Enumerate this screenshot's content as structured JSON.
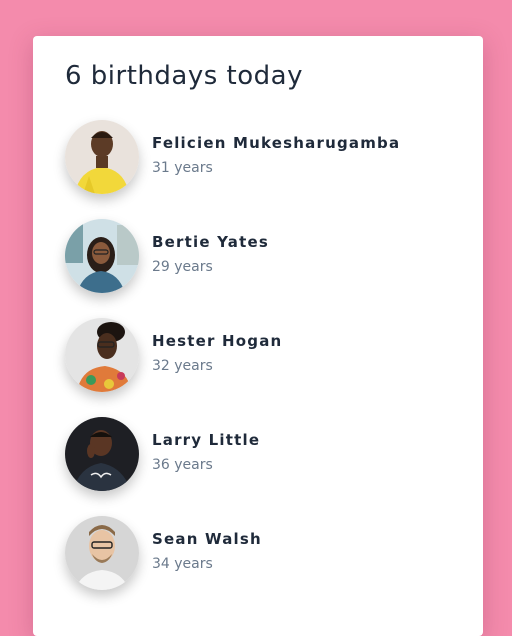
{
  "header": {
    "title": "6 birthdays today"
  },
  "people": [
    {
      "name": "Felicien Mukesharugamba",
      "age": "31 years",
      "avatar_icon": "person-photo-icon"
    },
    {
      "name": "Bertie Yates",
      "age": "29 years",
      "avatar_icon": "person-photo-icon"
    },
    {
      "name": "Hester Hogan",
      "age": "32 years",
      "avatar_icon": "person-photo-icon"
    },
    {
      "name": "Larry Little",
      "age": "36 years",
      "avatar_icon": "person-photo-icon"
    },
    {
      "name": "Sean Walsh",
      "age": "34 years",
      "avatar_icon": "person-photo-icon"
    }
  ],
  "colors": {
    "background": "#f48bac",
    "card": "#ffffff",
    "title_text": "#1f2a3a",
    "secondary_text": "#6b7a8c"
  }
}
